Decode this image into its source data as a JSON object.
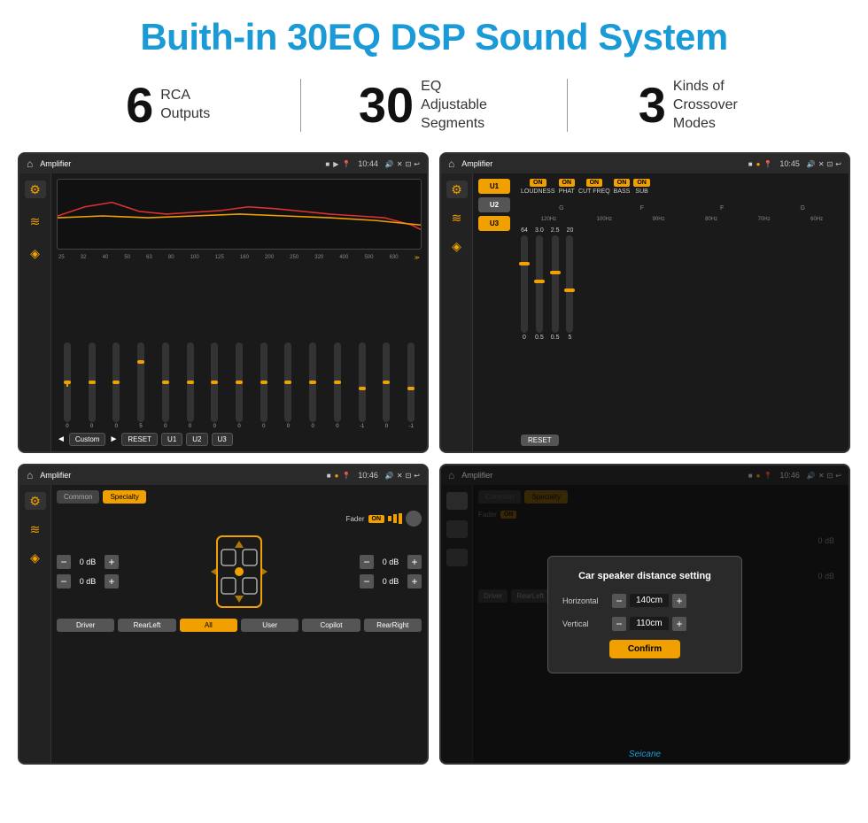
{
  "header": {
    "title": "Buith-in 30EQ DSP Sound System"
  },
  "stats": [
    {
      "number": "6",
      "label": "RCA\nOutputs"
    },
    {
      "number": "30",
      "label": "EQ Adjustable\nSegments"
    },
    {
      "number": "3",
      "label": "Kinds of\nCrossover Modes"
    }
  ],
  "screens": {
    "eq": {
      "title": "Amplifier",
      "time": "10:44",
      "frequencies": [
        "25",
        "32",
        "40",
        "50",
        "63",
        "80",
        "100",
        "125",
        "160",
        "200",
        "250",
        "320",
        "400",
        "500",
        "630"
      ],
      "values": [
        "0",
        "0",
        "0",
        "5",
        "0",
        "0",
        "0",
        "0",
        "0",
        "0",
        "0",
        "0",
        "-1",
        "0",
        "-1"
      ],
      "preset": "Custom",
      "buttons": [
        "RESET",
        "U1",
        "U2",
        "U3"
      ]
    },
    "amp": {
      "title": "Amplifier",
      "time": "10:45",
      "presets": [
        "U1",
        "U2",
        "U3"
      ],
      "toggles": [
        "LOUDNESS",
        "PHAT",
        "CUT FREQ",
        "BASS",
        "SUB"
      ],
      "resetLabel": "RESET"
    },
    "fader": {
      "title": "Amplifier",
      "time": "10:46",
      "tabs": [
        "Common",
        "Specialty"
      ],
      "faderLabel": "Fader",
      "faderOn": "ON",
      "controls": [
        {
          "label": "0 dB"
        },
        {
          "label": "0 dB"
        },
        {
          "label": "0 dB"
        },
        {
          "label": "0 dB"
        }
      ],
      "buttons": [
        "Driver",
        "RearLeft",
        "All",
        "User",
        "Copilot",
        "RearRight"
      ]
    },
    "dialog": {
      "title": "Amplifier",
      "time": "10:46",
      "dialogTitle": "Car speaker distance setting",
      "horizontal": "140cm",
      "vertical": "110cm",
      "horizontalLabel": "Horizontal",
      "verticalLabel": "Vertical",
      "confirmLabel": "Confirm",
      "rightLabel1": "0 dB",
      "rightLabel2": "0 dB"
    }
  },
  "watermark": "Seicane"
}
